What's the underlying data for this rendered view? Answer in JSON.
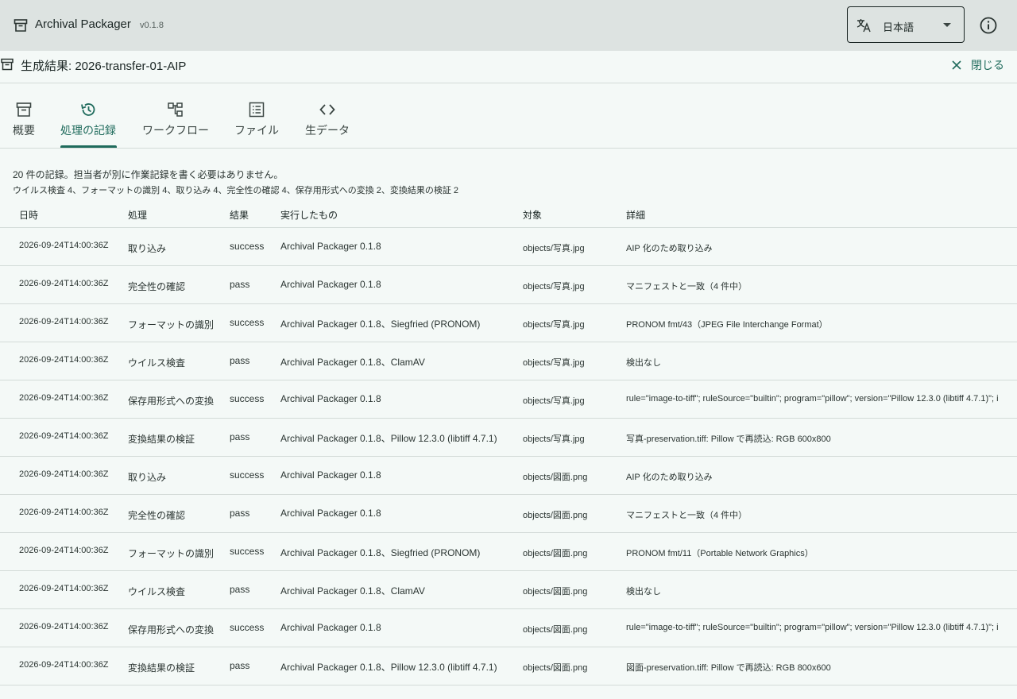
{
  "app": {
    "title": "Archival Packager",
    "version": "v0.1.8",
    "language": "日本語",
    "icons": {
      "app": "archive-box-icon",
      "language": "translate-icon",
      "info": "info-icon"
    }
  },
  "dialog": {
    "title": "生成結果: 2026-transfer-01-AIP",
    "close_label": "閉じる"
  },
  "tabs": [
    {
      "label": "概要",
      "icon": "archive-box-icon"
    },
    {
      "label": "処理の記録",
      "icon": "history-icon",
      "active": true
    },
    {
      "label": "ワークフロー",
      "icon": "workflow-icon"
    },
    {
      "label": "ファイル",
      "icon": "list-icon"
    },
    {
      "label": "生データ",
      "icon": "code-icon"
    }
  ],
  "summary": {
    "line1": "20 件の記録。担当者が別に作業記録を書く必要はありません。",
    "line2": "ウイルス検査 4、フォーマットの識別 4、取り込み 4、完全性の確認 4、保存用形式への変換 2、変換結果の検証 2"
  },
  "table": {
    "headers": [
      "日時",
      "処理",
      "結果",
      "実行したもの",
      "対象",
      "詳細"
    ],
    "rows": [
      [
        "2026-09-24T14:00:36Z",
        "取り込み",
        "success",
        "Archival Packager 0.1.8",
        "objects/写真.jpg",
        "AIP 化のため取り込み"
      ],
      [
        "2026-09-24T14:00:36Z",
        "完全性の確認",
        "pass",
        "Archival Packager 0.1.8",
        "objects/写真.jpg",
        "マニフェストと一致（4 件中）"
      ],
      [
        "2026-09-24T14:00:36Z",
        "フォーマットの識別",
        "success",
        "Archival Packager 0.1.8、Siegfried (PRONOM)",
        "objects/写真.jpg",
        "PRONOM fmt/43（JPEG File Interchange Format）"
      ],
      [
        "2026-09-24T14:00:36Z",
        "ウイルス検査",
        "pass",
        "Archival Packager 0.1.8、ClamAV",
        "objects/写真.jpg",
        "検出なし"
      ],
      [
        "2026-09-24T14:00:36Z",
        "保存用形式への変換",
        "success",
        "Archival Packager 0.1.8",
        "objects/写真.jpg",
        "rule=\"image-to-tiff\"; ruleSource=\"builtin\"; program=\"pillow\"; version=\"Pillow 12.3.0 (libtiff 4.7.1)\"; i"
      ],
      [
        "2026-09-24T14:00:36Z",
        "変換結果の検証",
        "pass",
        "Archival Packager 0.1.8、Pillow 12.3.0 (libtiff 4.7.1)",
        "objects/写真.jpg",
        "写真-preservation.tiff: Pillow で再読込: RGB 600x800"
      ],
      [
        "2026-09-24T14:00:36Z",
        "取り込み",
        "success",
        "Archival Packager 0.1.8",
        "objects/図面.png",
        "AIP 化のため取り込み"
      ],
      [
        "2026-09-24T14:00:36Z",
        "完全性の確認",
        "pass",
        "Archival Packager 0.1.8",
        "objects/図面.png",
        "マニフェストと一致（4 件中）"
      ],
      [
        "2026-09-24T14:00:36Z",
        "フォーマットの識別",
        "success",
        "Archival Packager 0.1.8、Siegfried (PRONOM)",
        "objects/図面.png",
        "PRONOM fmt/11（Portable Network Graphics）"
      ],
      [
        "2026-09-24T14:00:36Z",
        "ウイルス検査",
        "pass",
        "Archival Packager 0.1.8、ClamAV",
        "objects/図面.png",
        "検出なし"
      ],
      [
        "2026-09-24T14:00:36Z",
        "保存用形式への変換",
        "success",
        "Archival Packager 0.1.8",
        "objects/図面.png",
        "rule=\"image-to-tiff\"; ruleSource=\"builtin\"; program=\"pillow\"; version=\"Pillow 12.3.0 (libtiff 4.7.1)\"; i"
      ],
      [
        "2026-09-24T14:00:36Z",
        "変換結果の検証",
        "pass",
        "Archival Packager 0.1.8、Pillow 12.3.0 (libtiff 4.7.1)",
        "objects/図面.png",
        "図面-preservation.tiff: Pillow で再読込: RGB 800x600"
      ]
    ]
  },
  "colors": {
    "accent": "#1f6b5c",
    "appbar": "#dde3e1",
    "background": "#f4f9f7"
  }
}
